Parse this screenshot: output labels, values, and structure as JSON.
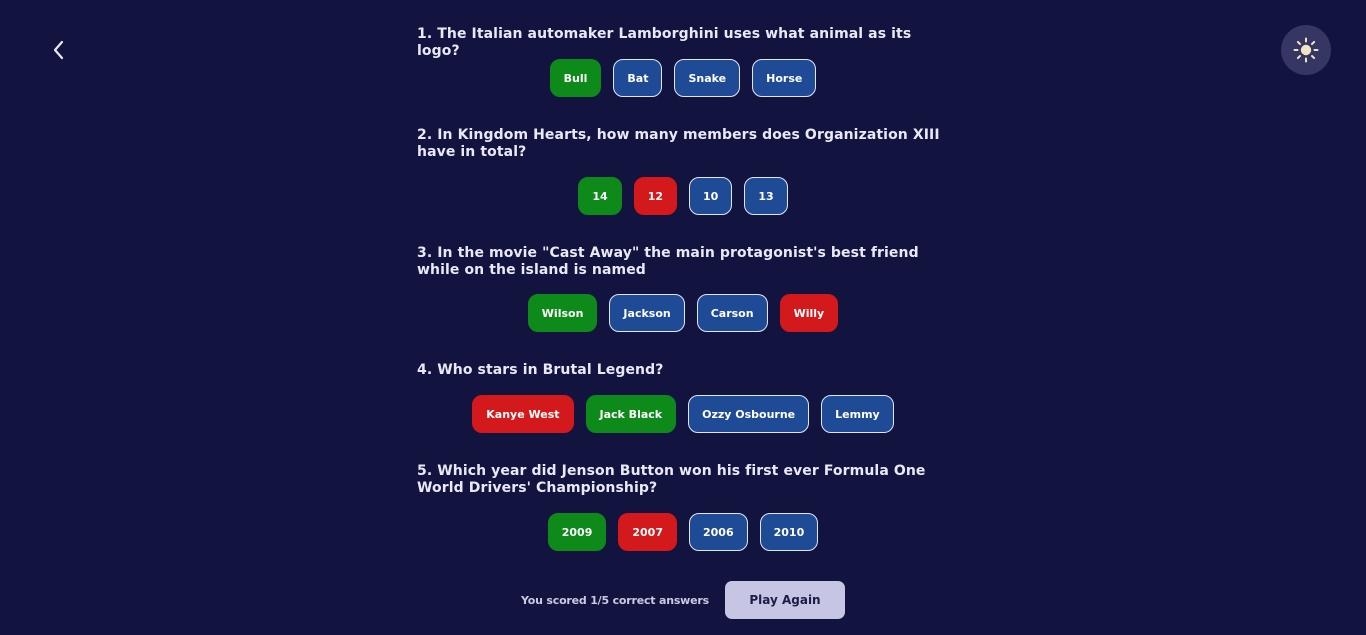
{
  "nav": {
    "back_icon": "chevron-left-icon",
    "theme_icon": "sun-icon"
  },
  "colors": {
    "background": "#13133f",
    "answer_default": "#1f4a96",
    "answer_correct": "#0d8a19",
    "answer_wrong": "#d3191b",
    "play_again_bg": "#c6c6e4"
  },
  "questions": [
    {
      "text": "1. The Italian automaker Lamborghini uses what animal as its logo?",
      "answers": [
        {
          "label": "Bull",
          "state": "correct"
        },
        {
          "label": "Bat",
          "state": "default"
        },
        {
          "label": "Snake",
          "state": "default"
        },
        {
          "label": "Horse",
          "state": "default"
        }
      ]
    },
    {
      "text": "2. In Kingdom Hearts, how many members does Organization XIII have in total?",
      "answers": [
        {
          "label": "14",
          "state": "correct"
        },
        {
          "label": "12",
          "state": "wrong"
        },
        {
          "label": "10",
          "state": "default"
        },
        {
          "label": "13",
          "state": "default"
        }
      ]
    },
    {
      "text": "3. In the movie \"Cast Away\" the main protagonist's best friend while on the island is named",
      "answers": [
        {
          "label": "Wilson",
          "state": "correct"
        },
        {
          "label": "Jackson",
          "state": "default"
        },
        {
          "label": "Carson",
          "state": "default"
        },
        {
          "label": "Willy",
          "state": "wrong"
        }
      ]
    },
    {
      "text": "4. Who stars in Brutal Legend?",
      "answers": [
        {
          "label": "Kanye West",
          "state": "wrong"
        },
        {
          "label": "Jack Black",
          "state": "correct"
        },
        {
          "label": "Ozzy Osbourne",
          "state": "default"
        },
        {
          "label": "Lemmy",
          "state": "default"
        }
      ]
    },
    {
      "text": "5. Which year did Jenson Button won his first ever Formula One World Drivers' Championship?",
      "answers": [
        {
          "label": "2009",
          "state": "correct"
        },
        {
          "label": "2007",
          "state": "wrong"
        },
        {
          "label": "2006",
          "state": "default"
        },
        {
          "label": "2010",
          "state": "default"
        }
      ]
    }
  ],
  "footer": {
    "score_text": "You scored 1/5 correct answers",
    "play_again_label": "Play Again"
  }
}
